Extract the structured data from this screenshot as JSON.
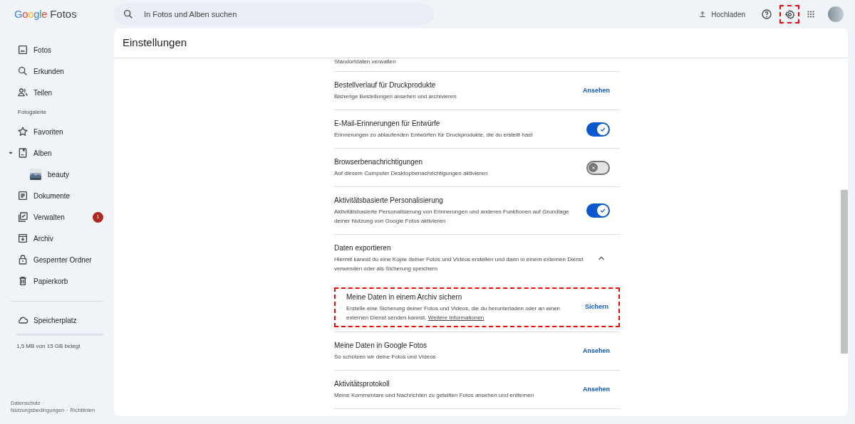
{
  "app": {
    "logo_word": "Google",
    "logo_product": "Fotos"
  },
  "search": {
    "placeholder": "In Fotos und Alben suchen"
  },
  "topbar": {
    "upload": "Hochladen",
    "settings_highlighted": true
  },
  "sidebar": {
    "items": [
      {
        "kind": "item",
        "label": "Fotos",
        "selected": false
      },
      {
        "kind": "item",
        "label": "Erkunden",
        "selected": false
      },
      {
        "kind": "item",
        "label": "Teilen",
        "selected": false
      },
      {
        "kind": "heading",
        "label": "Fotogalerie"
      },
      {
        "kind": "item",
        "label": "Favoriten",
        "selected": false
      },
      {
        "kind": "item",
        "label": "Alben",
        "selected": false,
        "expanded": true,
        "children": [
          {
            "kind": "album",
            "label": "beauty",
            "selected": false
          }
        ]
      },
      {
        "kind": "item",
        "label": "Dokumente",
        "selected": false
      },
      {
        "kind": "item",
        "label": "Verwalten",
        "selected": false,
        "badge": "1"
      },
      {
        "kind": "item",
        "label": "Archiv",
        "selected": false
      },
      {
        "kind": "item",
        "label": "Gesperrter Ordner",
        "selected": false
      },
      {
        "kind": "item",
        "label": "Papierkorb",
        "selected": false
      }
    ],
    "storage": {
      "label": "Speicherplatz",
      "level": 0,
      "usage": "1,5 MB von 15 GB belegt"
    },
    "footer": {
      "links": [
        "Datenschutz",
        "Nutzungsbedingungen",
        "Richtlinien"
      ],
      "separator": "·"
    }
  },
  "settings": {
    "title": "Einstellungen",
    "rows": [
      {
        "kind": "cut",
        "description": "Standortdaten verwalten"
      },
      {
        "kind": "link",
        "title": "Bestellverlauf für Druckprodukte",
        "description": "Bisherige Bestellungen ansehen und archivieren",
        "action": "Ansehen"
      },
      {
        "kind": "toggle",
        "title": "E-Mail-Erinnerungen für Entwürfe",
        "description": "Erinnerungen zu ablaufenden Entwürfen für Druckprodukte, die du erstellt hast",
        "on": true
      },
      {
        "kind": "toggle",
        "title": "Browserbenachrichtigungen",
        "description": "Auf diesem Computer Desktopbenachrichtigungen aktivieren",
        "on": false
      },
      {
        "kind": "toggle",
        "title": "Aktivitätsbasierte Personalisierung",
        "description": "Aktivitätsbasierte Personalisierung von Erinnerungen und anderen Funktionen auf Grundlage deiner Nutzung von Google Fotos aktivieren",
        "on": true
      },
      {
        "kind": "expand",
        "title": "Daten exportieren",
        "description": "Hiermit kannst du eine Kopie deiner Fotos und Videos erstellen und dann in einem externen Dienst verwenden oder als Sicherung speichern",
        "expanded": true,
        "children": [
          {
            "kind": "link",
            "title": "Meine Daten in einem Archiv sichern",
            "description": "Erstelle eine Sicherung deiner Fotos und Videos, die du herunterladen oder an einen externen Dienst senden kannst.",
            "link": "Weitere Informationen",
            "action": "Sichern",
            "highlighted": true
          }
        ]
      },
      {
        "kind": "link",
        "title": "Meine Daten in Google Fotos",
        "description": "So schützen wir deine Fotos und Videos",
        "action": "Ansehen"
      },
      {
        "kind": "link",
        "title": "Aktivitätsprotokoll",
        "description": "Meine Kommentare und Nachrichten zu geteilten Fotos ansehen und entfernen",
        "action": "Ansehen"
      }
    ]
  }
}
